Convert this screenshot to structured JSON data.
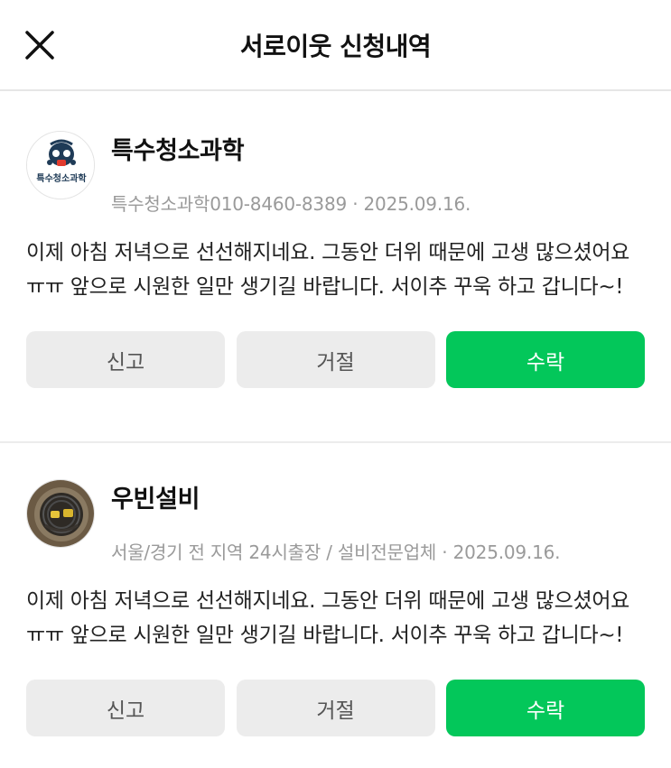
{
  "header": {
    "title": "서로이웃 신청내역",
    "close_icon": "close-icon"
  },
  "requests": [
    {
      "name": "특수청소과학",
      "avatar_label": "특수청소과학",
      "avatar_icon": "gas-mask-logo",
      "subtitle": "특수청소과학010-8460-8389",
      "date": "2025.09.16.",
      "message": "이제 아침 저녁으로 선선해지네요. 그동안 더위 때문에 고생 많으셨어요 ㅠㅠ 앞으로 시원한 일만 생기길 바랍니다. 서이추 꾸욱 하고 갑니다~!",
      "buttons": {
        "report": "신고",
        "reject": "거절",
        "accept": "수락"
      }
    },
    {
      "name": "우빈설비",
      "avatar_icon": "plumbing-photo",
      "subtitle": "서울/경기 전 지역 24시출장 / 설비전문업체",
      "date": "2025.09.16.",
      "message": "이제 아침 저녁으로 선선해지네요. 그동안 더위 때문에 고생 많으셨어요 ㅠㅠ 앞으로 시원한 일만 생기길 바랍니다. 서이추 꾸욱 하고 갑니다~!",
      "buttons": {
        "report": "신고",
        "reject": "거절",
        "accept": "수락"
      }
    }
  ],
  "colors": {
    "accept": "#03c75a",
    "secondary_button": "#ececec",
    "meta_text": "#9a9a9a",
    "divider": "#ececec"
  }
}
